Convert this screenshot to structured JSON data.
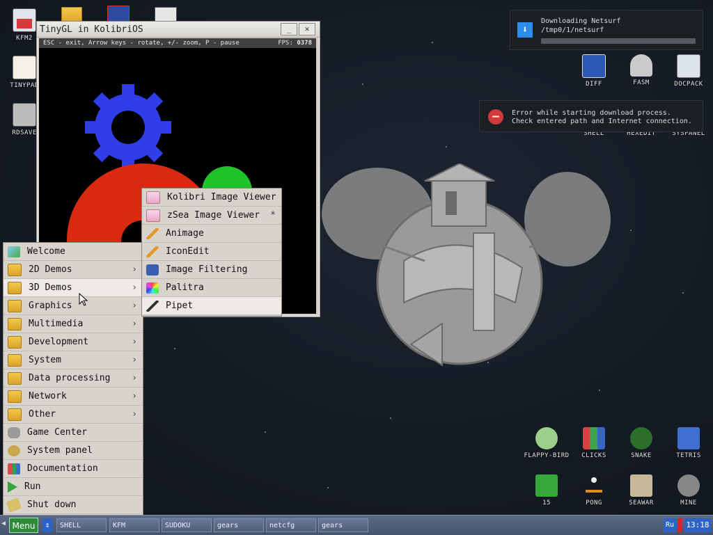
{
  "desktop_left_icons": [
    {
      "label": "KFM2",
      "icon": "floppy-icon"
    },
    {
      "label": "TINYPAD",
      "icon": "notepad-icon"
    },
    {
      "label": "RDSAVE",
      "icon": "disk-save-icon"
    }
  ],
  "desktop_right_icons": [
    {
      "label": "DIFF",
      "icon": "diff-icon"
    },
    {
      "label": "FASM",
      "icon": "fasm-icon"
    },
    {
      "label": "DOCPACK",
      "icon": "docpack-icon"
    },
    {
      "label": "SHELL",
      "icon": "shell-icon"
    },
    {
      "label": "HEXEDIT",
      "icon": "hexedit-icon"
    },
    {
      "label": "SYSPANEL",
      "icon": "syspanel-icon"
    },
    {
      "label": "FLAPPY-BIRD",
      "icon": "bird-icon"
    },
    {
      "label": "CLICKS",
      "icon": "clicks-icon"
    },
    {
      "label": "SNAKE",
      "icon": "snake-icon"
    },
    {
      "label": "TETRIS",
      "icon": "tetris-icon"
    },
    {
      "label": "15",
      "icon": "fifteen-icon"
    },
    {
      "label": "PONG",
      "icon": "pong-icon"
    },
    {
      "label": "SEAWAR",
      "icon": "ship-icon"
    },
    {
      "label": "MINE",
      "icon": "mine-icon"
    }
  ],
  "window": {
    "title": "TinyGL in KolibriOS",
    "hud_help": "ESC - exit, Arrow keys - rotate, +/- zoom, P - pause",
    "fps_label": "FPS:",
    "fps_value": "0378",
    "minimize": "_",
    "close": "✕"
  },
  "notifications": {
    "download_title": "Downloading Netsurf",
    "download_path": "/tmp0/1/netsurf",
    "download_progress": 0.0,
    "error_line1": "Error while starting download process.",
    "error_line2": "Check entered path and Internet connection."
  },
  "main_menu": [
    {
      "label": "Welcome",
      "icon": "welcome-icon",
      "submenu": false
    },
    {
      "label": "2D Demos",
      "icon": "folder-icon",
      "submenu": true
    },
    {
      "label": "3D Demos",
      "icon": "folder-icon",
      "submenu": true
    },
    {
      "label": "Graphics",
      "icon": "folder-icon",
      "submenu": true
    },
    {
      "label": "Multimedia",
      "icon": "folder-icon",
      "submenu": true
    },
    {
      "label": "Development",
      "icon": "folder-icon",
      "submenu": true
    },
    {
      "label": "System",
      "icon": "folder-icon",
      "submenu": true
    },
    {
      "label": "Data processing",
      "icon": "folder-icon",
      "submenu": true
    },
    {
      "label": "Network",
      "icon": "folder-icon",
      "submenu": true
    },
    {
      "label": "Other",
      "icon": "folder-icon",
      "submenu": true
    },
    {
      "label": "Game Center",
      "icon": "gamepad-icon",
      "submenu": false
    },
    {
      "label": "System panel",
      "icon": "gears-icon",
      "submenu": false
    },
    {
      "label": "Documentation",
      "icon": "books-icon",
      "submenu": false
    },
    {
      "label": "Run",
      "icon": "play-icon",
      "submenu": false
    },
    {
      "label": "Shut down",
      "icon": "shutdown-icon",
      "submenu": false
    }
  ],
  "submenu": [
    {
      "label": "Kolibri Image Viewer",
      "icon": "image-icon",
      "mark": ""
    },
    {
      "label": "zSea Image Viewer",
      "icon": "image-icon",
      "mark": "*"
    },
    {
      "label": "Animage",
      "icon": "pencil-icon",
      "mark": ""
    },
    {
      "label": "IconEdit",
      "icon": "pencil-icon",
      "mark": ""
    },
    {
      "label": "Image Filtering",
      "icon": "filter-icon",
      "mark": ""
    },
    {
      "label": "Palitra",
      "icon": "palette-icon",
      "mark": ""
    },
    {
      "label": "Pipet",
      "icon": "pipette-icon",
      "mark": ""
    }
  ],
  "taskbar": {
    "menu_label": "Menu",
    "scroll_glyph": "⇕",
    "tasks": [
      "SHELL",
      "KFM",
      "SUDOKU",
      "gears",
      "netcfg",
      "gears"
    ],
    "lang": "Ru",
    "clock": "13:18"
  },
  "colors": {
    "accent": "#2e8b3a",
    "taskbar": "#4f5c77",
    "menu_bg": "#d8d4cd"
  }
}
